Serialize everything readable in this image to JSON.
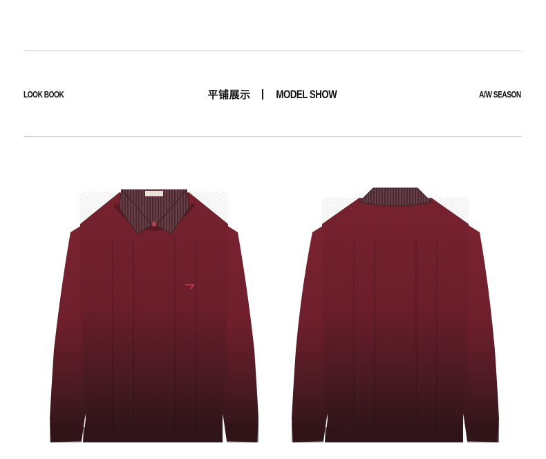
{
  "header": {
    "left_label": "LOOK BOOK",
    "center_cn": "平铺展示",
    "center_en": "MODEL SHOW",
    "right_label": "A/W SEASON"
  },
  "colors": {
    "sweater_top": "#7a2330",
    "sweater_bottom": "#2a1418",
    "collar_stripe": "#5b3b40",
    "rule": "#cfcfcf"
  },
  "products": [
    {
      "view": "front"
    },
    {
      "view": "back"
    }
  ]
}
